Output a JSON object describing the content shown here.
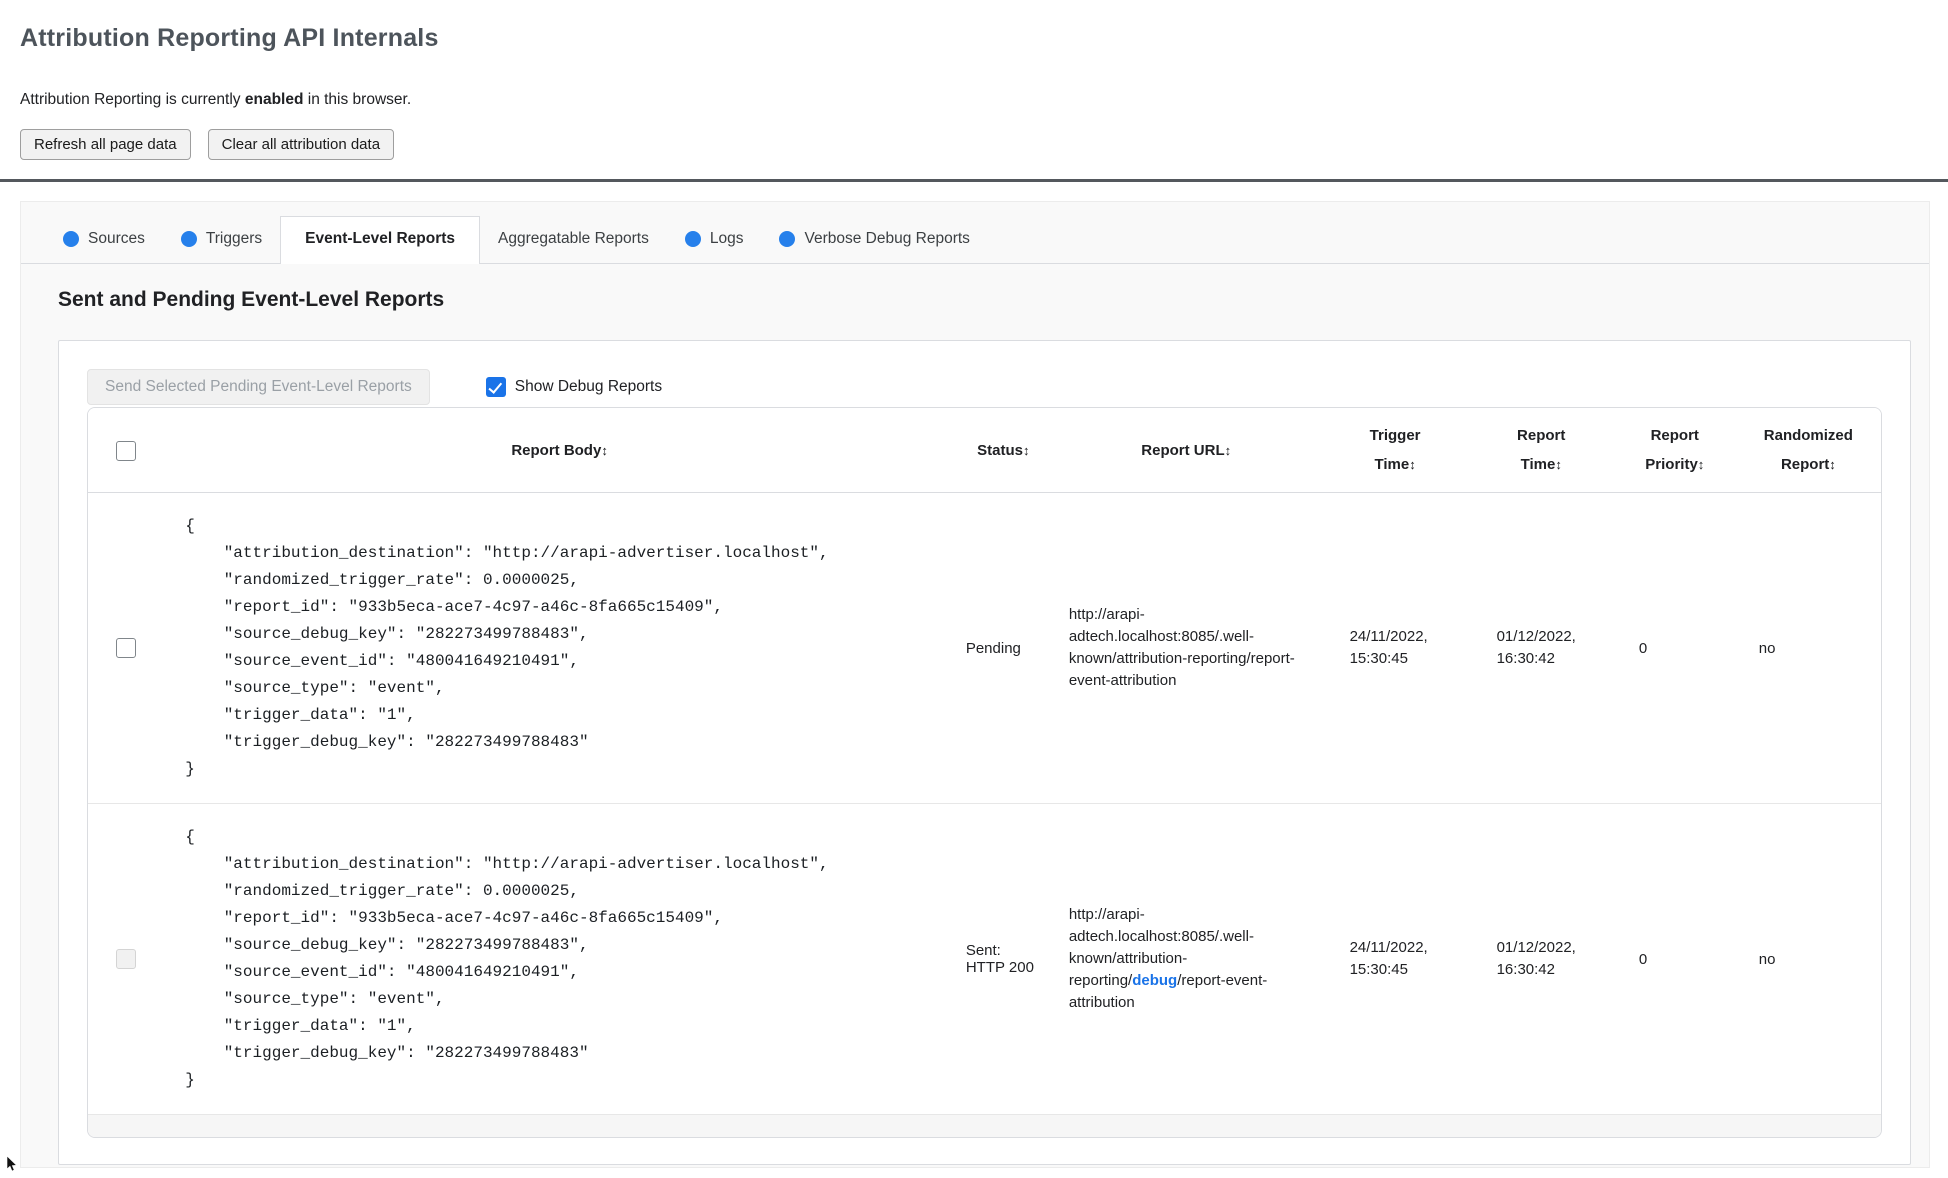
{
  "header": {
    "title": "Attribution Reporting API Internals",
    "intro_prefix": "Attribution Reporting is currently ",
    "intro_status": "enabled",
    "intro_suffix": " in this browser.",
    "refresh_button": "Refresh all page data",
    "clear_button": "Clear all attribution data"
  },
  "tabs": [
    {
      "label": "Sources",
      "has_dot": true,
      "active": false
    },
    {
      "label": "Triggers",
      "has_dot": true,
      "active": false
    },
    {
      "label": "Event-Level Reports",
      "has_dot": false,
      "active": true
    },
    {
      "label": "Aggregatable Reports",
      "has_dot": false,
      "active": false
    },
    {
      "label": "Logs",
      "has_dot": true,
      "active": false
    },
    {
      "label": "Verbose Debug Reports",
      "has_dot": true,
      "active": false
    }
  ],
  "colors": {
    "tab_dot_blue": "#2680eb",
    "debug_link_blue": "#1a73e8",
    "checkbox_blue": "#1a73e8"
  },
  "section": {
    "heading": "Sent and Pending Event-Level Reports",
    "send_button": "Send Selected Pending Event-Level Reports",
    "show_debug_label": "Show Debug Reports"
  },
  "table": {
    "sort_indicator": "↕",
    "columns": [
      "Report Body",
      "Status",
      "Report URL",
      "Trigger Time",
      "Report Time",
      "Report Priority",
      "Randomized Report"
    ],
    "rows": [
      {
        "checkbox_enabled": true,
        "report_body": "{\n    \"attribution_destination\": \"http://arapi-advertiser.localhost\",\n    \"randomized_trigger_rate\": 0.0000025,\n    \"report_id\": \"933b5eca-ace7-4c97-a46c-8fa665c15409\",\n    \"source_debug_key\": \"282273499788483\",\n    \"source_event_id\": \"480041649210491\",\n    \"source_type\": \"event\",\n    \"trigger_data\": \"1\",\n    \"trigger_debug_key\": \"282273499788483\"\n}",
        "status": "Pending",
        "url": "http://arapi-adtech.localhost:8085/.well-known/attribution-reporting/report-event-attribution",
        "trigger_time": "24/11/2022, 15:30:45",
        "report_time": "01/12/2022, 16:30:42",
        "report_priority": "0",
        "randomized_report": "no"
      },
      {
        "checkbox_enabled": false,
        "report_body": "{\n    \"attribution_destination\": \"http://arapi-advertiser.localhost\",\n    \"randomized_trigger_rate\": 0.0000025,\n    \"report_id\": \"933b5eca-ace7-4c97-a46c-8fa665c15409\",\n    \"source_debug_key\": \"282273499788483\",\n    \"source_event_id\": \"480041649210491\",\n    \"source_type\": \"event\",\n    \"trigger_data\": \"1\",\n    \"trigger_debug_key\": \"282273499788483\"\n}",
        "status": "Sent: HTTP 200",
        "url_prefix": "http://arapi-adtech.localhost:8085/.well-known/attribution-reporting/",
        "url_debug": "debug",
        "url_suffix": "/report-event-attribution",
        "trigger_time": "24/11/2022, 15:30:45",
        "report_time": "01/12/2022, 16:30:42",
        "report_priority": "0",
        "randomized_report": "no"
      }
    ]
  }
}
